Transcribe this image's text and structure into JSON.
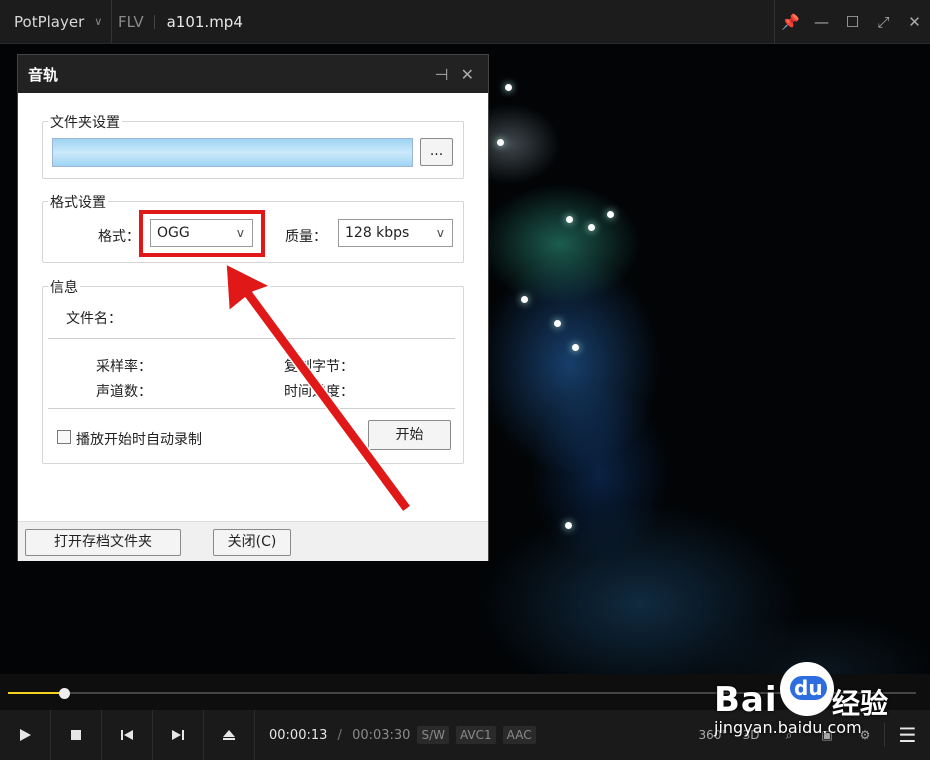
{
  "titlebar": {
    "app_name": "PotPlayer",
    "format": "FLV",
    "file_name": "a101.mp4",
    "pin": "📌",
    "minimize": "—",
    "maximize": "☐",
    "fullscreen": "⤢",
    "close": "✕"
  },
  "dialog": {
    "title": "音轨",
    "folder_settings": {
      "legend": "文件夹设置",
      "browse_label": "..."
    },
    "format_settings": {
      "legend": "格式设置",
      "format_label": "格式：",
      "format_value": "OGG",
      "quality_label": "质量：",
      "quality_value": "128 kbps"
    },
    "info": {
      "legend": "信息",
      "filename_label": "文件名：",
      "sample_rate_label": "采样率：",
      "channels_label": "声道数：",
      "copied_bytes_label": "复制字节：",
      "time_progress_label": "时间进度："
    },
    "auto_record_label": "播放开始时自动录制",
    "start_button": "开始",
    "open_folder_button": "打开存档文件夹",
    "close_button": "关闭(C)"
  },
  "controls": {
    "current_time": "00:00:13",
    "separator": "/",
    "duration": "00:03:30",
    "tags": [
      "S/W",
      "AVC1",
      "AAC"
    ],
    "progress_fraction": 0.062,
    "right_icons": [
      "360°",
      "3D"
    ],
    "accent_color": "#f2d21e"
  },
  "annotation": {
    "highlight_color": "#e01818"
  },
  "watermark": {
    "baidu": "Bai",
    "jingyan": "经验",
    "url": "jingyan.baidu.com"
  }
}
